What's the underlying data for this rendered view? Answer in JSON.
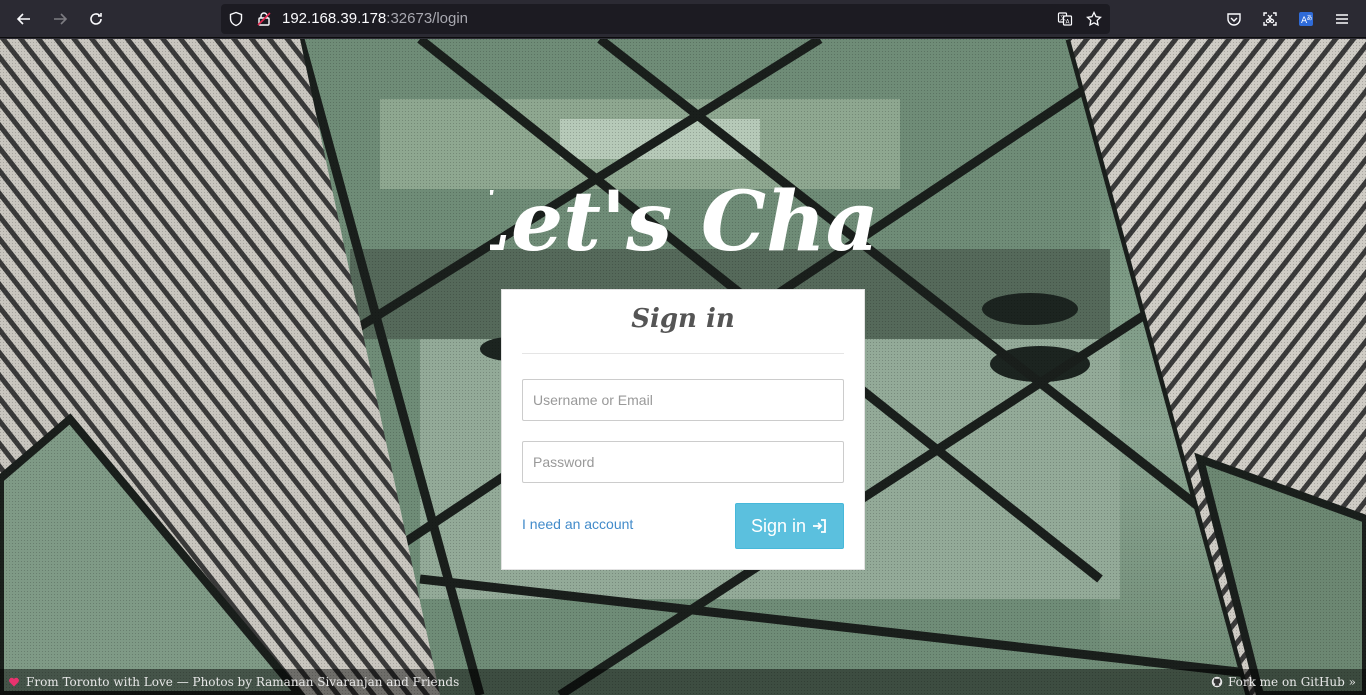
{
  "browser": {
    "url_host": "192.168.39.178",
    "url_path": ":32673/login",
    "icons": [
      "back-arrow-icon",
      "forward-arrow-icon",
      "reload-icon",
      "shield-icon",
      "insecure-lock-icon",
      "translate-icon",
      "bookmark-star-icon",
      "pocket-icon",
      "screenshot-icon",
      "extension-translate-icon",
      "menu-icon"
    ]
  },
  "brand": {
    "text": "Let's Chat",
    "accent_color": "#e8336e"
  },
  "login": {
    "title": "Sign in",
    "username_placeholder": "Username or Email",
    "password_placeholder": "Password",
    "register_link": "I need an account",
    "submit_label": "Sign in",
    "submit_color": "#5bc0de"
  },
  "footer": {
    "credit": "From Toronto with Love — Photos by Ramanan Sivaranjan and Friends",
    "github": "Fork me on GitHub »",
    "heart_color": "#e8336e"
  }
}
